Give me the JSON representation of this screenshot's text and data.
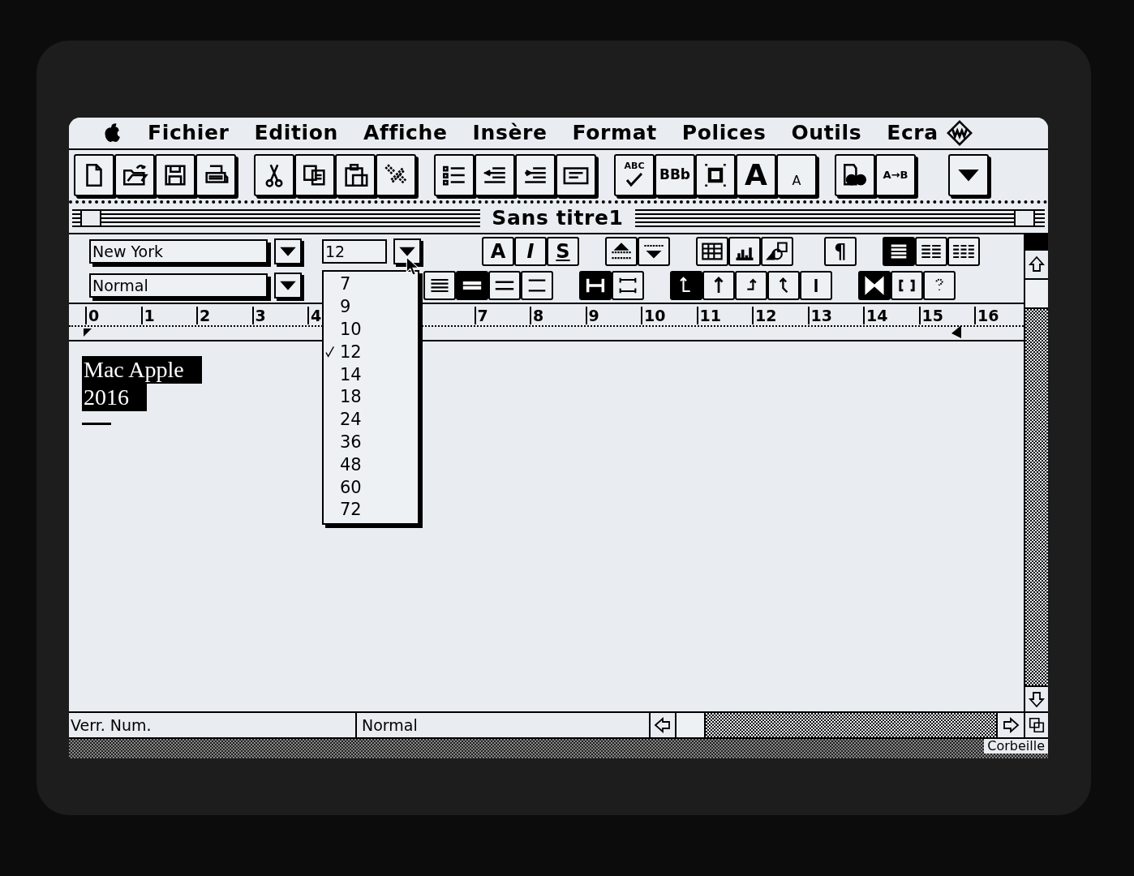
{
  "menu_bar": {
    "items": [
      "Fichier",
      "Edition",
      "Affiche",
      "Insère",
      "Format",
      "Polices",
      "Outils",
      "Ecra"
    ]
  },
  "toolbar": {
    "text_buttons": [
      "ABC",
      "BBb",
      "A",
      "A",
      "A→B"
    ]
  },
  "window": {
    "title": "Sans titre1"
  },
  "format_bar": {
    "font": "New York",
    "style": "Normal",
    "size": "12",
    "char_buttons": [
      "A",
      "I",
      "S"
    ],
    "pilcrow": "¶",
    "columns": [
      {
        "selected": true
      },
      {
        "selected": false
      },
      {
        "selected": false
      }
    ],
    "alignment": [
      {
        "selected": false
      },
      {
        "selected": true
      },
      {
        "selected": false
      },
      {
        "selected": false
      }
    ],
    "spacing": [
      {
        "selected": true
      },
      {
        "selected": false
      }
    ],
    "tabs": [
      {
        "selected": true
      },
      {
        "selected": false
      },
      {
        "selected": false
      },
      {
        "selected": false
      },
      {
        "selected": false
      }
    ],
    "borders": [
      {
        "selected": true
      },
      {
        "selected": false
      },
      {
        "selected": false
      }
    ]
  },
  "ruler": {
    "left_labels": [
      "0",
      "1",
      "2",
      "3",
      "4"
    ],
    "right_labels": [
      "7",
      "8",
      "9",
      "10",
      "11",
      "12",
      "13",
      "14",
      "15",
      "16"
    ]
  },
  "size_menu": {
    "items": [
      {
        "label": "7",
        "checked": false
      },
      {
        "label": "9",
        "checked": false
      },
      {
        "label": "10",
        "checked": false
      },
      {
        "label": "12",
        "checked": true
      },
      {
        "label": "14",
        "checked": false
      },
      {
        "label": "18",
        "checked": false
      },
      {
        "label": "24",
        "checked": false
      },
      {
        "label": "36",
        "checked": false
      },
      {
        "label": "48",
        "checked": false
      },
      {
        "label": "60",
        "checked": false
      },
      {
        "label": "72",
        "checked": false
      }
    ]
  },
  "document": {
    "lines": [
      {
        "text": "Mac Apple",
        "selected": true
      },
      {
        "text": "2016",
        "selected": true
      }
    ]
  },
  "status_bar": {
    "lock": "Verr. Num.",
    "style": "Normal"
  },
  "desktop": {
    "trash_label": "Corbeille"
  }
}
